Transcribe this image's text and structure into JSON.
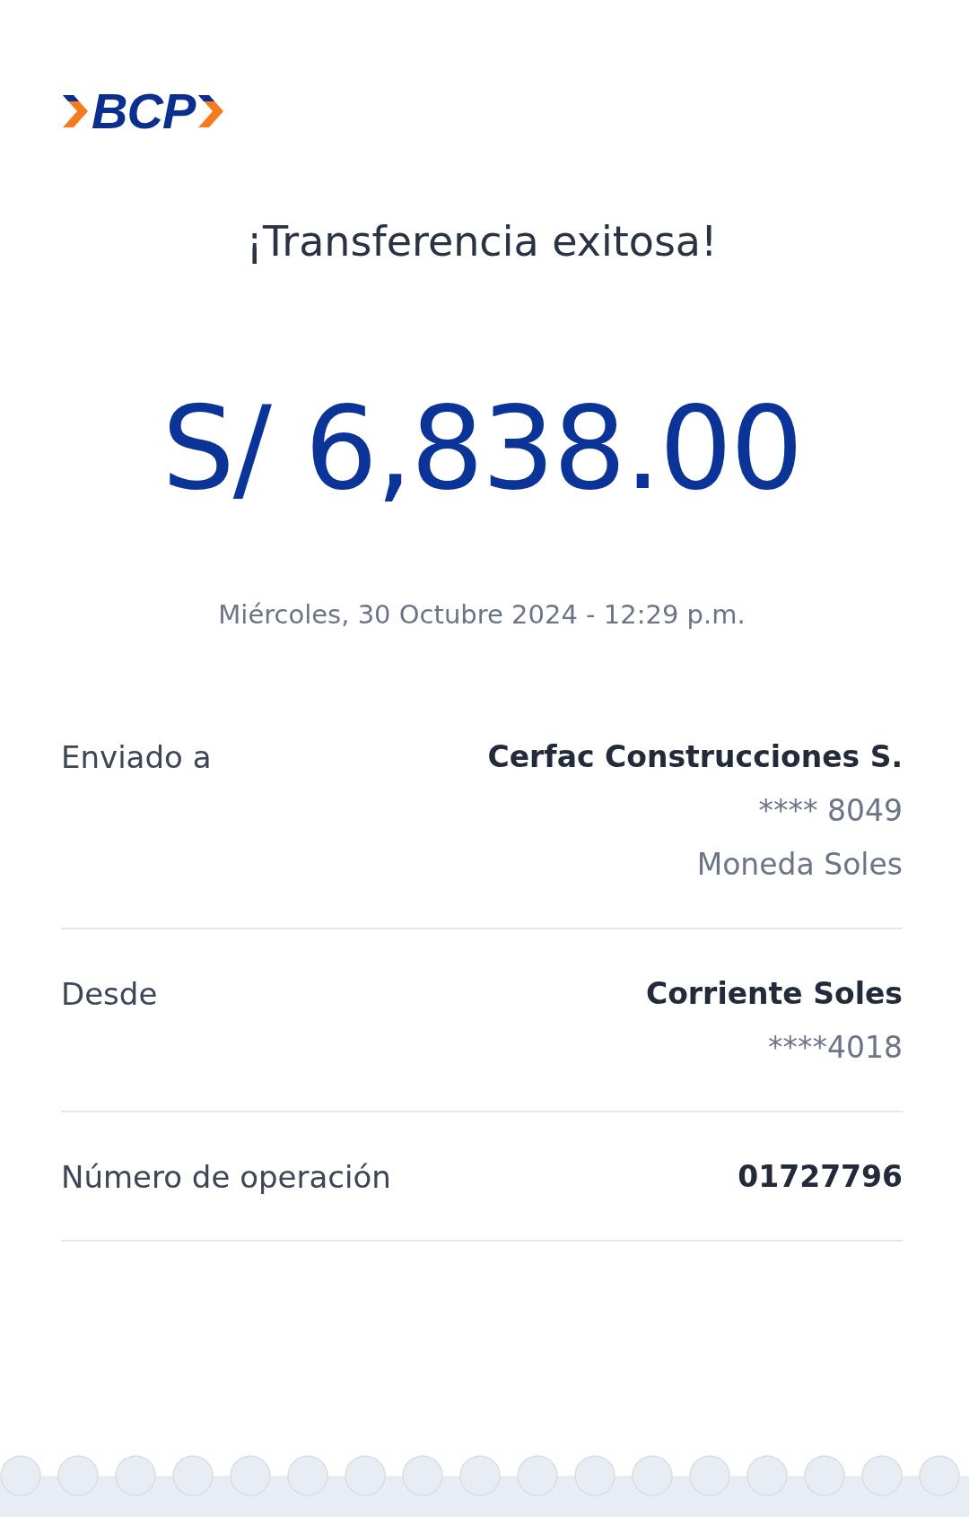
{
  "logo": {
    "text": "BCP"
  },
  "title": "¡Transferencia exitosa!",
  "amount": "S/ 6,838.00",
  "datetime": "Miércoles, 30 Octubre 2024 - 12:29 p.m.",
  "details": [
    {
      "label": "Enviado a",
      "lines": [
        {
          "text": "Cerfac Construcciones S.",
          "kind": "strong"
        },
        {
          "text": "**** 8049",
          "kind": "muted"
        },
        {
          "text": "Moneda Soles",
          "kind": "muted"
        }
      ]
    },
    {
      "label": "Desde",
      "lines": [
        {
          "text": "Corriente Soles",
          "kind": "strong"
        },
        {
          "text": "****4018",
          "kind": "muted"
        }
      ]
    },
    {
      "label": "Número de operación",
      "lines": [
        {
          "text": "01727796",
          "kind": "strong"
        }
      ]
    }
  ]
}
